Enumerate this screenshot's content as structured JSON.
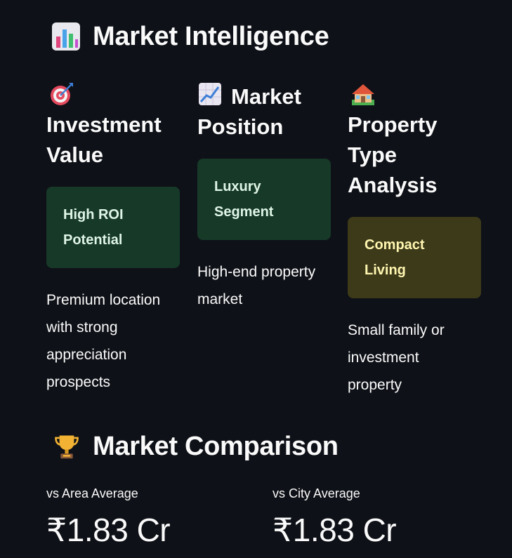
{
  "intelligence": {
    "title": "Market Intelligence",
    "icon": "bar-chart-icon",
    "columns": [
      {
        "icon": "target-icon",
        "heading_line1": "Investment",
        "heading_line2": "Value",
        "badge_line1": "High ROI",
        "badge_line2": "Potential",
        "badge_color": "#173928",
        "desc_line1": "Premium location",
        "desc_line2": "with strong",
        "desc_line3": "appreciation",
        "desc_line4": "prospects"
      },
      {
        "icon": "trending-up-icon",
        "heading_line1": "Market",
        "heading_line2": "Position",
        "badge_line1": "Luxury",
        "badge_line2": "Segment",
        "badge_color": "#173928",
        "desc_line1": "High-end property",
        "desc_line2": "market"
      },
      {
        "icon": "house-icon",
        "heading_line1": "Property",
        "heading_line2": "Type",
        "heading_line3": "Analysis",
        "badge_line1": "Compact",
        "badge_line2": "Living",
        "badge_color": "#3d3a1a",
        "desc_line1": "Small family or",
        "desc_line2": "investment",
        "desc_line3": "property"
      }
    ]
  },
  "comparison": {
    "title": "Market Comparison",
    "icon": "trophy-icon",
    "metrics": [
      {
        "label": "vs Area Average",
        "value": "₹1.83 Cr"
      },
      {
        "label": "vs City Average",
        "value": "₹1.83 Cr"
      }
    ]
  }
}
